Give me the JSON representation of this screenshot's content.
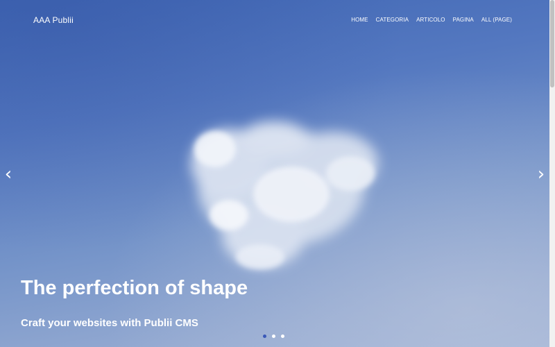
{
  "brand": {
    "title": "AAA Publii"
  },
  "nav": {
    "items": [
      {
        "label": "HOME"
      },
      {
        "label": "CATEGORIA"
      },
      {
        "label": "ARTICOLO"
      },
      {
        "label": "PAGINA"
      },
      {
        "label": "ALL (PAGE)"
      }
    ]
  },
  "slider": {
    "prev_icon": "‹",
    "next_icon": "›",
    "headline": "The perfection of shape",
    "subheadline": "Craft your websites with Publii CMS",
    "slide_count": 3,
    "active_slide": 1
  },
  "colors": {
    "sky_top": "#3f66b4",
    "sky_bottom": "#a0b3d6",
    "active_dot": "#3a58b8",
    "text": "#ffffff"
  }
}
